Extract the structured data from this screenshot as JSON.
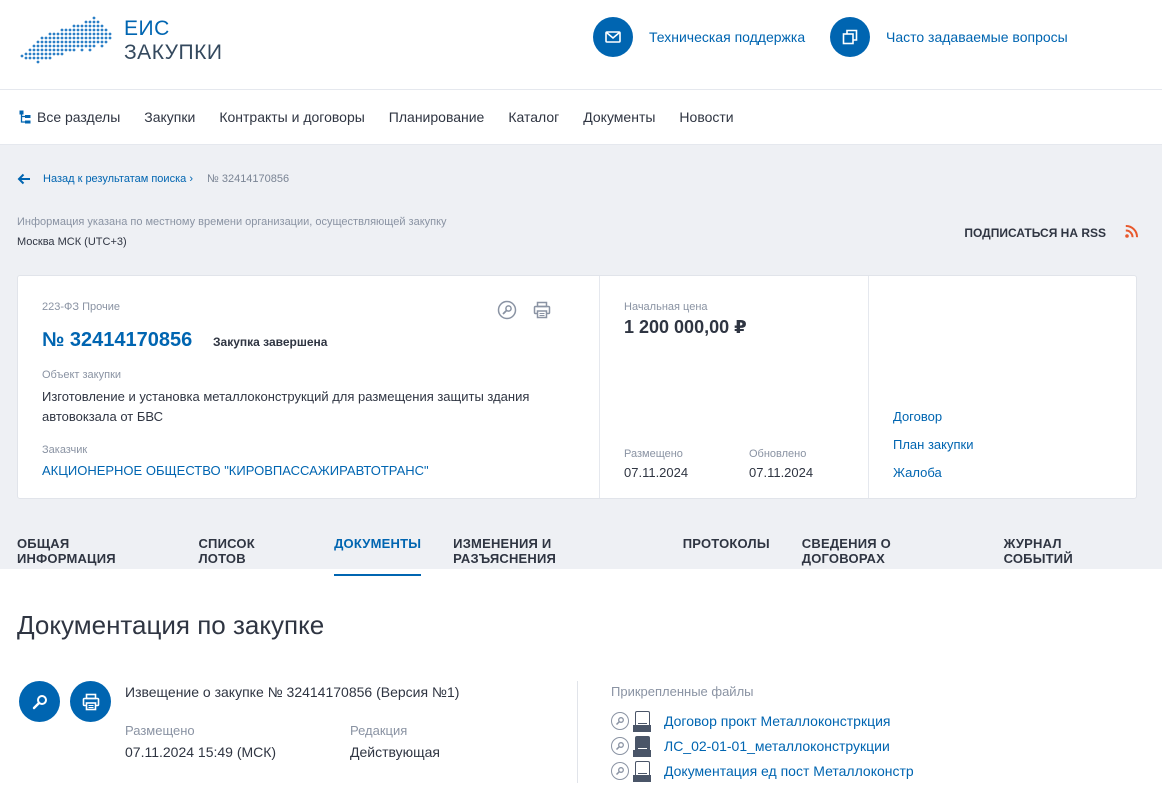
{
  "header": {
    "logo_line1": "ЕИС",
    "logo_line2": "ЗАКУПКИ",
    "support_label": "Техническая поддержка",
    "faq_label": "Часто задаваемые вопросы"
  },
  "nav": {
    "items": [
      "Все разделы",
      "Закупки",
      "Контракты и договоры",
      "Планирование",
      "Каталог",
      "Документы",
      "Новости"
    ]
  },
  "breadcrumb": {
    "back_label": "Назад к результатам поиска",
    "separator": "›",
    "current": "№ 32414170856"
  },
  "timezone": {
    "note": "Информация указана по местному времени организации, осуществляющей закупку",
    "value": "Москва МСК (UTC+3)"
  },
  "rss_label": "ПОДПИСАТЬСЯ НА RSS",
  "card": {
    "law": "223-ФЗ Прочие",
    "number": "№ 32414170856",
    "status": "Закупка завершена",
    "object_label": "Объект закупки",
    "object_value": "Изготовление и установка металлоконструкций для размещения защиты здания автовокзала от БВС",
    "customer_label": "Заказчик",
    "customer_value": "АКЦИОНЕРНОЕ ОБЩЕСТВО \"КИРОВПАССАЖИРАВТОТРАНС\"",
    "price_label": "Начальная цена",
    "price_value": "1 200 000,00 ₽",
    "placed_label": "Размещено",
    "placed_value": "07.11.2024",
    "updated_label": "Обновлено",
    "updated_value": "07.11.2024",
    "links": [
      "Договор",
      "План закупки",
      "Жалоба"
    ]
  },
  "tabs": [
    "ОБЩАЯ ИНФОРМАЦИЯ",
    "СПИСОК ЛОТОВ",
    "ДОКУМЕНТЫ",
    "ИЗМЕНЕНИЯ И РАЗЪЯСНЕНИЯ",
    "ПРОТОКОЛЫ",
    "СВЕДЕНИЯ О ДОГОВОРАХ",
    "ЖУРНАЛ СОБЫТИЙ"
  ],
  "active_tab": "ДОКУМЕНТЫ",
  "docs": {
    "title": "Документация по закупке",
    "notice_title": "Извещение о закупке № 32414170856 (Версия №1)",
    "placed_label": "Размещено",
    "placed_value": "07.11.2024 15:49 (МСК)",
    "edition_label": "Редакция",
    "edition_value": "Действующая",
    "files_label": "Прикрепленные файлы",
    "files": [
      "Договор прокт Металлоконстркция",
      "ЛС_02-01-01_металлоконструкции",
      "Документация ед пост Металлоконстр"
    ]
  },
  "colors": {
    "brand_blue": "#0065b1",
    "rss_orange": "#e8582c",
    "grey_bg": "#eef0f4"
  },
  "icons": [
    "russia-map-logo",
    "mail-icon",
    "windows-icon",
    "sitemap-icon",
    "arrow-left-icon",
    "rss-icon",
    "magnifier-icon",
    "printer-icon",
    "file-icon"
  ]
}
